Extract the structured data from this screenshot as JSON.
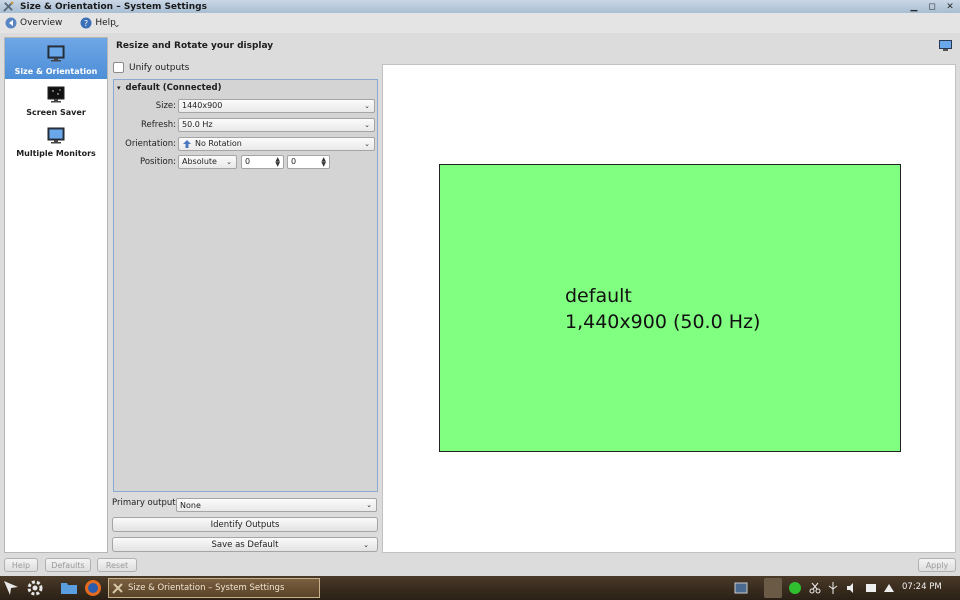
{
  "window": {
    "title": "Size & Orientation – System Settings"
  },
  "toolbar": {
    "overview_label": "Overview",
    "help_label": "Help"
  },
  "sidebar": {
    "items": [
      {
        "label": "Size & Orientation",
        "active": true,
        "icon": "monitor-icon"
      },
      {
        "label": "Screen Saver",
        "active": false,
        "icon": "screen-saver-icon"
      },
      {
        "label": "Multiple Monitors",
        "active": false,
        "icon": "monitor-icon"
      }
    ]
  },
  "main": {
    "title": "Resize and Rotate your display"
  },
  "unify": {
    "label": "Unify outputs"
  },
  "output": {
    "header": "default (Connected)",
    "size_label": "Size:",
    "size_value": "1440x900",
    "refresh_label": "Refresh:",
    "refresh_value": "50.0 Hz",
    "orientation_label": "Orientation:",
    "orientation_value": "No Rotation",
    "position_label": "Position:",
    "position_mode": "Absolute",
    "position_x": "0",
    "position_y": "0"
  },
  "preview": {
    "name": "default",
    "resolution": "1,440x900 (50.0 Hz)",
    "screen_color": "#80ff80"
  },
  "bottom": {
    "primary_label": "Primary output:",
    "primary_value": "None",
    "identify_label": "Identify Outputs",
    "save_label": "Save as Default"
  },
  "dialog": {
    "help": "Help",
    "defaults": "Defaults",
    "reset": "Reset",
    "apply": "Apply"
  },
  "taskbar": {
    "task_label": "Size & Orientation – System Settings",
    "clock": "07:24 PM"
  }
}
